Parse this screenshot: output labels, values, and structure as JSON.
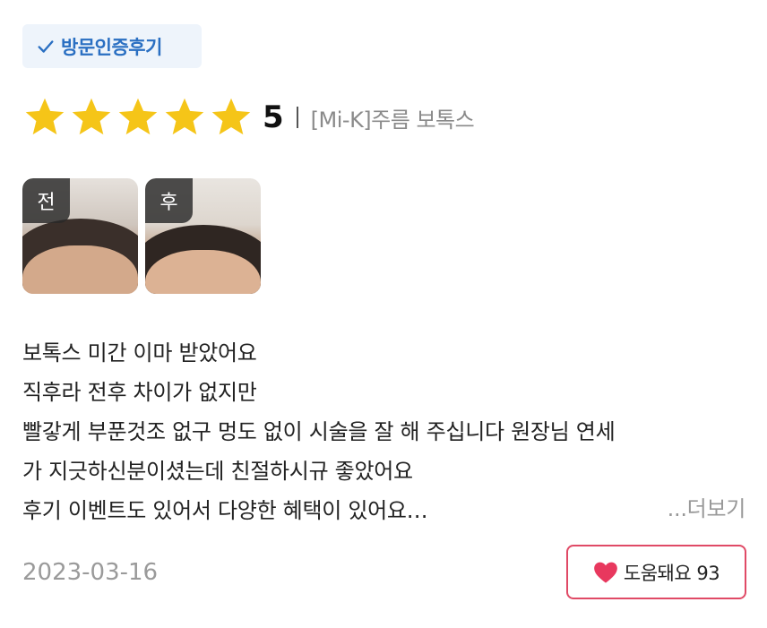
{
  "badge": {
    "label": "방문인증후기",
    "icon": "check-icon",
    "color": "#2a6fc2"
  },
  "rating": {
    "stars": 5,
    "max_stars": 5,
    "score": "5",
    "procedure": "[Mi-K]주름 보톡스",
    "star_color": "#f5c518"
  },
  "photos": [
    {
      "tag": "전"
    },
    {
      "tag": "후"
    }
  ],
  "review": {
    "lines": [
      "보톡스 미간 이마 받았어요",
      "직후라 전후 차이가 없지만",
      "빨갛게 부푼것조 없구 멍도 없이 시술을 잘 해 주십니다 원장님 연세",
      "가 지긋하신분이셨는데 친절하시규 좋았어요",
      "후기 이벤트도 있어서 다양한 혜택이 있어요…"
    ],
    "more_label": "...더보기"
  },
  "date": "2023-03-16",
  "helpful": {
    "label": "도움돼요 93",
    "icon": "heart-icon",
    "color": "#e04a66"
  }
}
